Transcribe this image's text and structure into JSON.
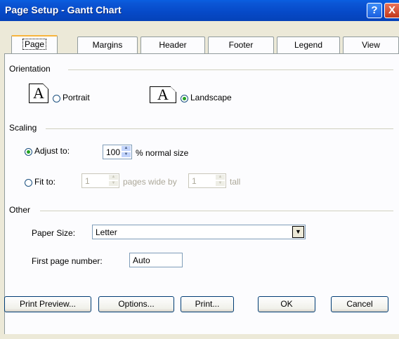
{
  "window": {
    "title": "Page Setup - Gantt Chart",
    "help_glyph": "?",
    "close_glyph": "X"
  },
  "tabs": [
    {
      "label": "Page",
      "active": true
    },
    {
      "label": "Margins",
      "active": false
    },
    {
      "label": "Header",
      "active": false
    },
    {
      "label": "Footer",
      "active": false
    },
    {
      "label": "Legend",
      "active": false
    },
    {
      "label": "View",
      "active": false
    }
  ],
  "orientation": {
    "heading": "Orientation",
    "icon_letter": "A",
    "portrait_label": "Portrait",
    "landscape_label": "Landscape",
    "selected": "landscape"
  },
  "scaling": {
    "heading": "Scaling",
    "adjust_label": "Adjust to:",
    "adjust_value": "100",
    "adjust_suffix": "% normal size",
    "fit_label": "Fit to:",
    "fit_wide_value": "1",
    "fit_wide_suffix": "pages wide by",
    "fit_tall_value": "1",
    "fit_tall_suffix": "tall",
    "selected": "adjust"
  },
  "other": {
    "heading": "Other",
    "paper_size_label": "Paper Size:",
    "paper_size_value": "Letter",
    "first_page_label": "First page number:",
    "first_page_value": "Auto"
  },
  "buttons": {
    "print_preview": "Print Preview...",
    "options": "Options...",
    "print": "Print...",
    "ok": "OK",
    "cancel": "Cancel"
  },
  "colors": {
    "titlebar": "#0649c7",
    "dialog_bg": "#ece9d8",
    "panel_bg": "#fcfcfe",
    "radio_dot": "#21a121"
  }
}
